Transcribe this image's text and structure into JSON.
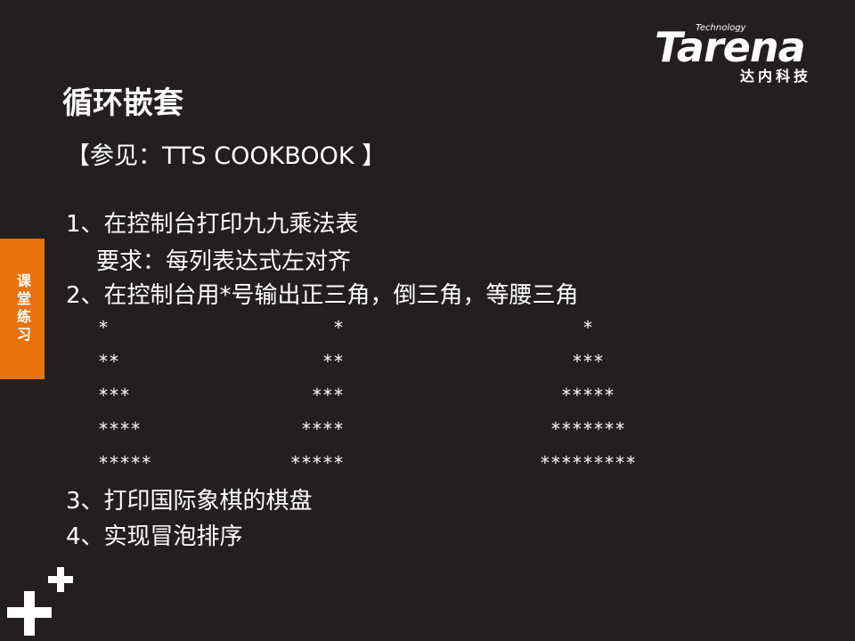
{
  "logo": {
    "small": "Technology",
    "main": "Tarena",
    "cn": "达内科技"
  },
  "title": "循环嵌套",
  "reference": "【参见：TTS  COOKBOOK 】",
  "side_tab": "课堂练习",
  "items": {
    "item1": "1、在控制台打印九九乘法表",
    "item1_sub": "要求：每列表达式左对齐",
    "item2": "2、在控制台用*号输出正三角，倒三角，等腰三角",
    "item3": "3、打印国际象棋的棋盘",
    "item4": "4、实现冒泡排序"
  },
  "patterns": {
    "left": [
      "*",
      "**",
      "***",
      "****",
      "*****"
    ],
    "middle": [
      "*",
      "**",
      "***",
      "****",
      "*****"
    ],
    "right": [
      "*",
      "***",
      "*****",
      "*******",
      "*********"
    ]
  },
  "colors": {
    "background": "#231f20",
    "accent": "#e8720c",
    "text": "#ffffff"
  },
  "decoration": "plus-icon"
}
